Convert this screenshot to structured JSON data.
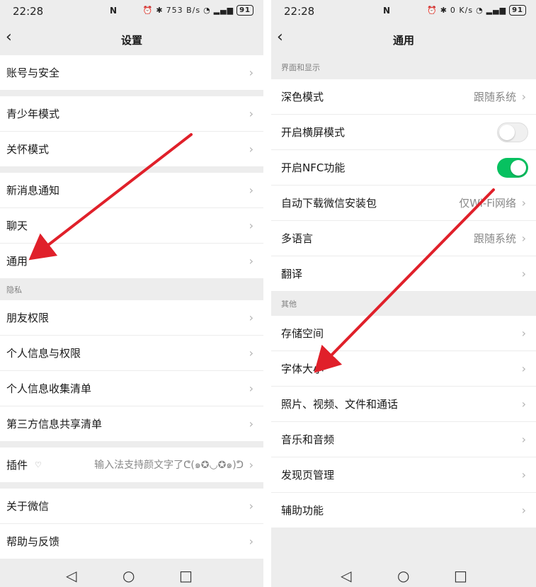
{
  "left": {
    "status": {
      "time": "22:28",
      "nfc": "N",
      "net_speed": "753 B/s",
      "battery": "91"
    },
    "title": "设置",
    "groups": [
      {
        "items": [
          {
            "label": "账号与安全"
          }
        ]
      },
      {
        "items": [
          {
            "label": "青少年模式"
          },
          {
            "label": "关怀模式"
          }
        ]
      },
      {
        "items": [
          {
            "label": "新消息通知"
          },
          {
            "label": "聊天"
          },
          {
            "label": "通用"
          }
        ]
      },
      {
        "section": "隐私",
        "items": [
          {
            "label": "朋友权限"
          },
          {
            "label": "个人信息与权限"
          },
          {
            "label": "个人信息收集清单"
          },
          {
            "label": "第三方信息共享清单"
          }
        ]
      },
      {
        "items": [
          {
            "label": "插件",
            "value": "输入法支持颜文字了ᕦ(๑✪◡✪๑)ᕤ"
          }
        ]
      },
      {
        "items": [
          {
            "label": "关于微信"
          },
          {
            "label": "帮助与反馈"
          }
        ]
      }
    ]
  },
  "right": {
    "status": {
      "time": "22:28",
      "nfc": "N",
      "net_speed": "0 K/s",
      "battery": "91"
    },
    "title": "通用",
    "section1": "界面和显示",
    "display_items": [
      {
        "label": "深色模式",
        "value": "跟随系统"
      },
      {
        "label": "开启横屏模式",
        "toggle": "off"
      },
      {
        "label": "开启NFC功能",
        "toggle": "on"
      },
      {
        "label": "自动下载微信安装包",
        "value": "仅Wi-Fi网络"
      },
      {
        "label": "多语言",
        "value": "跟随系统"
      },
      {
        "label": "翻译"
      }
    ],
    "section2": "其他",
    "other_items": [
      {
        "label": "存储空间"
      },
      {
        "label": "字体大小"
      },
      {
        "label": "照片、视频、文件和通话"
      },
      {
        "label": "音乐和音频"
      },
      {
        "label": "发现页管理"
      },
      {
        "label": "辅助功能"
      }
    ]
  },
  "glyphs": {
    "chevron": "›",
    "back": "‹",
    "nav_back": "◁",
    "nav_home": "○",
    "nav_recent": "□",
    "shield": "♡"
  },
  "colors": {
    "accent_green": "#07c160",
    "annotation_red": "#e0202a",
    "page_bg": "#ededed"
  }
}
